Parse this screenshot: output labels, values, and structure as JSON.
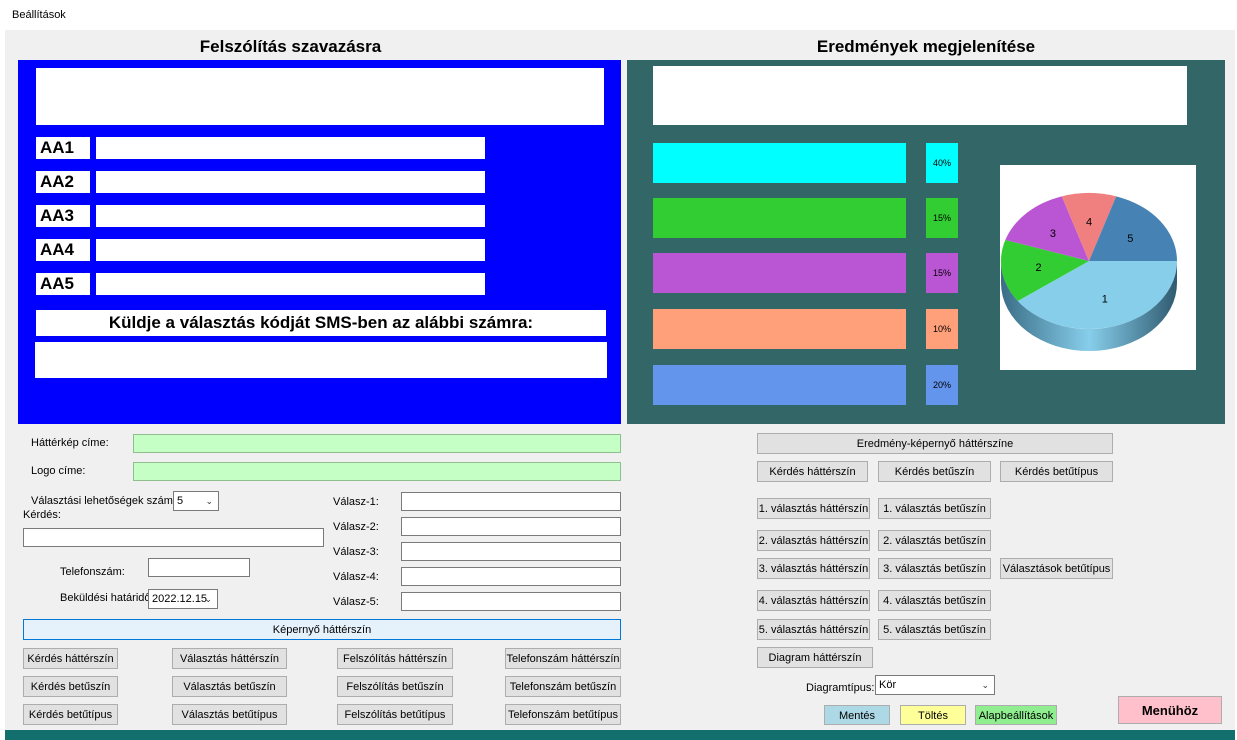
{
  "window": {
    "title": "Beállítások"
  },
  "left": {
    "heading": "Felszólítás szavazásra",
    "answer_codes": [
      "AA1",
      "AA2",
      "AA3",
      "AA4",
      "AA5"
    ],
    "sms_prompt": "Küldje a választás kódját SMS-ben az alábbi számra:"
  },
  "right": {
    "heading": "Eredmények megjelenítése",
    "bars": [
      {
        "percent_label": "40%",
        "value": 40,
        "color": "#00ffff"
      },
      {
        "percent_label": "15%",
        "value": 15,
        "color": "#32cd32"
      },
      {
        "percent_label": "15%",
        "value": 15,
        "color": "#ba55d3"
      },
      {
        "percent_label": "10%",
        "value": 10,
        "color": "#ffa07a"
      },
      {
        "percent_label": "20%",
        "value": 20,
        "color": "#6495ed"
      }
    ],
    "pie": {
      "type": "pie",
      "slices": [
        {
          "label": "1",
          "value": 40,
          "color": "#87ceeb"
        },
        {
          "label": "2",
          "value": 15,
          "color": "#32cd32"
        },
        {
          "label": "3",
          "value": 15,
          "color": "#ba55d3"
        },
        {
          "label": "4",
          "value": 10,
          "color": "#f08080"
        },
        {
          "label": "5",
          "value": 20,
          "color": "#4682b4"
        }
      ]
    }
  },
  "form": {
    "background_image_label": "Háttérkép címe:",
    "logo_label": "Logo címe:",
    "options_count_label": "Választási lehetőségek száma:",
    "options_count_value": "5",
    "question_label": "Kérdés:",
    "phone_label": "Telefonszám:",
    "deadline_label": "Beküldési határidő",
    "deadline_value": "2022.12.15",
    "answer_labels": [
      "Válasz-1:",
      "Válasz-2:",
      "Válasz-3:",
      "Válasz-4:",
      "Válasz-5:"
    ],
    "screen_bg_button": "Képernyő háttérszín",
    "buttons": [
      [
        "Kérdés háttérszín",
        "Választás háttérszín",
        "Felszólítás háttérszín",
        "Telefonszám háttérszín"
      ],
      [
        "Kérdés betűszín",
        "Választás betűszín",
        "Felszólítás betűszín",
        "Telefonszám betűszín"
      ],
      [
        "Kérdés betűtípus",
        "Választás betűtípus",
        "Felszólítás betűtípus",
        "Telefonszám betűtípus"
      ]
    ]
  },
  "results_form": {
    "screen_bg_button": "Eredmény-képernyő háttérszíne",
    "question_buttons": [
      "Kérdés háttérszín",
      "Kérdés betűszín",
      "Kérdés betűtípus"
    ],
    "choice_bg_buttons": [
      "1. választás háttérszín",
      "2. választás háttérszín",
      "3. választás háttérszín",
      "4. választás háttérszín",
      "5. választás háttérszín"
    ],
    "choice_fg_buttons": [
      "1. választás betűszín",
      "2. választás betűszín",
      "3. választás betűszín",
      "4. választás betűszín",
      "5. választás betűszín"
    ],
    "choices_font_button": "Választások betűtípus",
    "diagram_bg_button": "Diagram háttérszín",
    "diagram_type_label": "Diagramtípus:",
    "diagram_type_value": "Kör",
    "save_button": "Mentés",
    "load_button": "Töltés",
    "defaults_button": "Alapbeállítások",
    "menu_button": "Menühöz"
  },
  "colors": {
    "left_panel": "#0000ff",
    "right_panel": "#336666",
    "save": "#add8e6",
    "load": "#ffff99",
    "defaults": "#90ee90",
    "menu": "#ffc0cb"
  }
}
